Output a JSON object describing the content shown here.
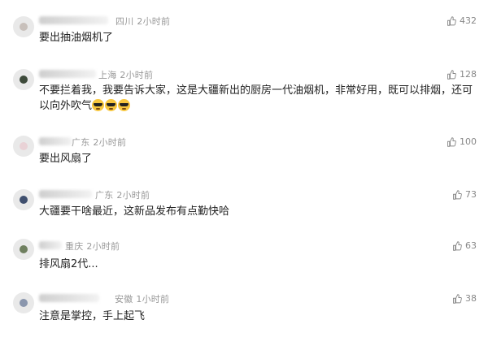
{
  "comments": [
    {
      "location": "四川",
      "time": "2小时前",
      "text": "要出抽油烟机了",
      "likes": "432",
      "emoji_count": 0,
      "avatar_color": "#c8c0bb"
    },
    {
      "location": "上海",
      "time": "2小时前",
      "text": "不要拦着我，我要告诉大家，这是大疆新出的厨房一代油烟机，非常好用，既可以排烟，还可以向外吹气",
      "likes": "128",
      "emoji_count": 3,
      "emoji_name": "cool-sunglasses-emoji",
      "avatar_color": "#3d4a3a"
    },
    {
      "location": "广东",
      "time": "2小时前",
      "text": "要出风扇了",
      "likes": "100",
      "emoji_count": 0,
      "avatar_color": "#e9d2d6"
    },
    {
      "location": "广东",
      "time": "2小时前",
      "text": "大疆要干啥最近，这新品发布有点勤快哈",
      "likes": "73",
      "emoji_count": 0,
      "avatar_color": "#3f4f6e"
    },
    {
      "location": "重庆",
      "time": "2小时前",
      "text": "排风扇2代...",
      "likes": "63",
      "emoji_count": 0,
      "avatar_color": "#6f7f5f"
    },
    {
      "location": "安徽",
      "time": "1小时前",
      "text": "注意是掌控，手上起飞",
      "likes": "38",
      "emoji_count": 0,
      "avatar_color": "#8a96ad"
    }
  ],
  "icons": {
    "like": "thumbs-up-icon"
  }
}
